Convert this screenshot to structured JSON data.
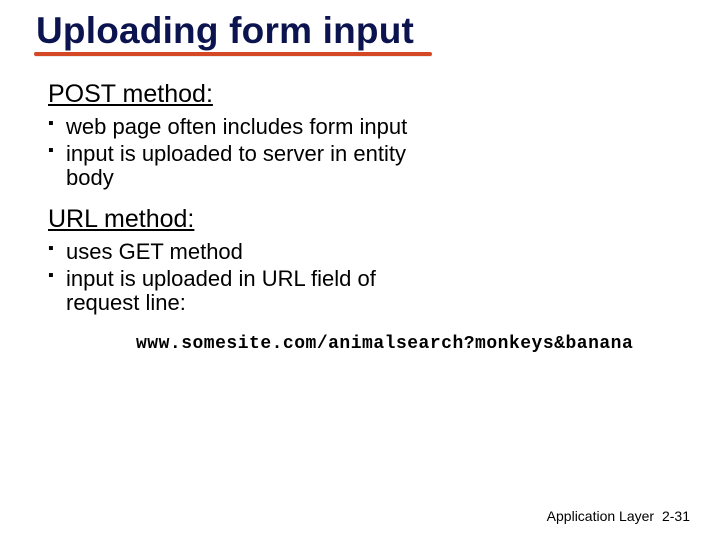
{
  "title": "Uploading form input",
  "sections": [
    {
      "heading": "POST method:",
      "bullets": [
        "web page often includes form input",
        "input is uploaded to server in entity body"
      ]
    },
    {
      "heading": "URL method:",
      "bullets": [
        "uses GET method",
        "input is uploaded in URL field of request line:"
      ]
    }
  ],
  "example": "www.somesite.com/animalsearch?monkeys&banana",
  "footer": {
    "label": "Application Layer",
    "page": "2-31"
  },
  "colors": {
    "title": "#0c1450",
    "underline": "#d44826"
  }
}
